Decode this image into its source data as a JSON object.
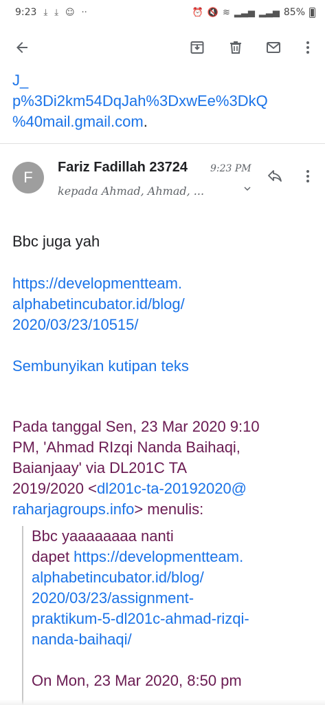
{
  "status_bar": {
    "time": "9:23",
    "notification_icons": [
      "download-icon",
      "download-icon",
      "wechat-icon"
    ],
    "more": "··",
    "battery_percent": "85%"
  },
  "app_bar": {
    "icons": [
      "back-arrow-icon",
      "archive-icon",
      "delete-icon",
      "mail-icon",
      "more-vert-icon"
    ]
  },
  "prev_message_tail": {
    "line1": "J_",
    "line2": "p%3Di2km54DqJah%3DxwEe%3DkQ",
    "line3": "%40mail.gmail.com",
    "trailing": "."
  },
  "message": {
    "avatar_letter": "F",
    "sender": "Fariz Fadillah 23724",
    "time": "9:23 PM",
    "recipients": "kepada Ahmad, Ahmad, ...",
    "body": "Bbc juga yah",
    "link": {
      "line1": "https://developmentteam.",
      "line2": "alphabetincubator.id/blog/",
      "line3": "2020/03/23/10515/"
    },
    "hide_quoted": "Sembunyikan kutipan teks",
    "quote_intro": {
      "line1": "Pada tanggal Sen, 23 Mar 2020 9:10",
      "line2": "PM, 'Ahmad RIzqi Nanda Baihaqi,",
      "line3": "Baianjaay' via DL201C TA",
      "line4_prefix": "2019/2020 <",
      "email_part1": "dl201c-ta-20192020@",
      "email_part2": "raharjagroups.info",
      "line5_suffix": "> menulis:"
    },
    "quoted": {
      "line1": "Bbc yaaaaaaaa nanti",
      "line2_prefix": "dapet ",
      "link_line1": "https://developmentteam.",
      "link_line2": "alphabetincubator.id/blog/",
      "link_line3": "2020/03/23/assignment-",
      "link_line4": "praktikum-5-dl201c-ahmad-rizqi-",
      "link_line5": "nanda-baihaqi/",
      "cutoff": "On Mon, 23 Mar 2020, 8:50 pm"
    }
  }
}
